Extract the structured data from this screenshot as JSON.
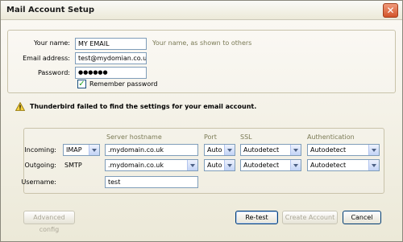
{
  "window": {
    "title": "Mail Account Setup"
  },
  "account": {
    "name_label": "Your name:",
    "name_value": "MY EMAIL",
    "name_hint": "Your name, as shown to others",
    "email_label": "Email address:",
    "email_value": "test@mydomian.co.uk",
    "password_label": "Password:",
    "password_value": "●●●●●●",
    "remember_label": "Remember password",
    "remember_checked": true
  },
  "status": {
    "message": "Thunderbird failed to find the settings for your email account."
  },
  "server": {
    "headers": {
      "hostname": "Server hostname",
      "port": "Port",
      "ssl": "SSL",
      "auth": "Authentication"
    },
    "incoming": {
      "label": "Incoming:",
      "protocol": "IMAP",
      "hostname": ".mydomain.co.uk",
      "port": "Auto",
      "ssl": "Autodetect",
      "auth": "Autodetect"
    },
    "outgoing": {
      "label": "Outgoing:",
      "protocol": "SMTP",
      "hostname": ".mydomain.co.uk",
      "port": "Auto",
      "ssl": "Autodetect",
      "auth": "Autodetect"
    },
    "username_label": "Username:",
    "username_value": "test"
  },
  "buttons": {
    "advanced": "Advanced config",
    "retest": "Re-test",
    "create": "Create Account",
    "cancel": "Cancel"
  },
  "icons": {
    "warning": "warning-icon",
    "close": "close-icon",
    "dropdown": "chevron-down-icon"
  }
}
